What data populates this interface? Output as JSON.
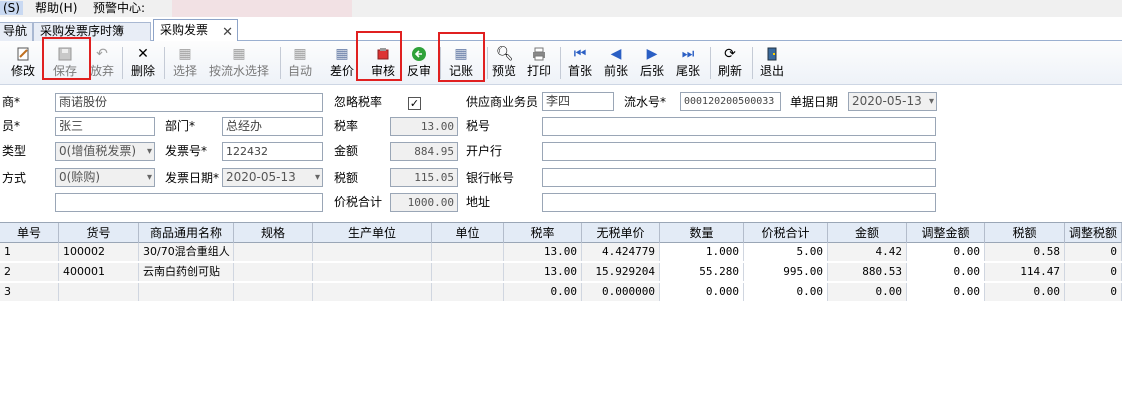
{
  "menu": {
    "item_s": "(S)",
    "help": "帮助(H)",
    "alert_center": "预警中心:"
  },
  "tabs": [
    {
      "label": "导航"
    },
    {
      "label": "采购发票序时簿"
    },
    {
      "label": "采购发票",
      "close": "✕"
    }
  ],
  "toolbar": {
    "modify": "修改",
    "save": "保存",
    "discard": "放弃",
    "delete": "删除",
    "select": "选择",
    "select_by_serial": "按流水选择",
    "auto": "自动",
    "difference": "差价",
    "audit": "审核",
    "unaudit": "反审",
    "post": "记账",
    "preview": "预览",
    "print": "打印",
    "first": "首张",
    "prev": "前张",
    "next": "后张",
    "last": "尾张",
    "refresh": "刷新",
    "exit": "退出"
  },
  "form": {
    "supplier_label": "商*",
    "supplier_value": "雨诺股份",
    "ignore_tax_label": "忽略税率",
    "ignore_tax_check": "✓",
    "supplier_agent_label": "供应商业务员",
    "supplier_agent_value": "李四",
    "serial_label": "流水号*",
    "serial_value": "000120200500033",
    "doc_date_label": "单据日期",
    "doc_date_value": "2020-05-13",
    "staff_label": "员*",
    "staff_value": "张三",
    "dept_label": "部门*",
    "dept_value": "总经办",
    "tax_rate_label": "税率",
    "tax_rate_value": "13.00",
    "tax_no_label": "税号",
    "tax_no_value": "",
    "type_label": "类型",
    "type_value": "0(增值税发票)",
    "invoice_no_label": "发票号*",
    "invoice_no_value": "122432",
    "amount_label": "金额",
    "amount_value": "884.95",
    "bank_label": "开户行",
    "bank_value": "",
    "method_label": "方式",
    "method_value": "0(赊购)",
    "invoice_date_label": "发票日期*",
    "invoice_date_value": "2020-05-13",
    "tax_amount_label": "税额",
    "tax_amount_value": "115.05",
    "account_label": "银行帐号",
    "account_value": "",
    "blank_label": "",
    "blank_value": "",
    "total_label": "价税合计",
    "total_value": "1000.00",
    "address_label": "地址",
    "address_value": ""
  },
  "grid": {
    "headers": [
      "单号",
      "货号",
      "商品通用名称",
      "规格",
      "生产单位",
      "单位",
      "税率",
      "无税单价",
      "数量",
      "价税合计",
      "金额",
      "调整金额",
      "税额",
      "调整税额"
    ],
    "rows": [
      [
        "1",
        "100002",
        "30/70混合重组人",
        "",
        "",
        "",
        "13.00",
        "4.424779",
        "1.000",
        "5.00",
        "4.42",
        "0.00",
        "0.58",
        "0"
      ],
      [
        "2",
        "400001",
        "云南白药创可贴",
        "",
        "",
        "",
        "13.00",
        "15.929204",
        "55.280",
        "995.00",
        "880.53",
        "0.00",
        "114.47",
        "0"
      ],
      [
        "3",
        "",
        "",
        "",
        "",
        "",
        "0.00",
        "0.000000",
        "0.000",
        "0.00",
        "0.00",
        "0.00",
        "0.00",
        "0"
      ]
    ]
  }
}
